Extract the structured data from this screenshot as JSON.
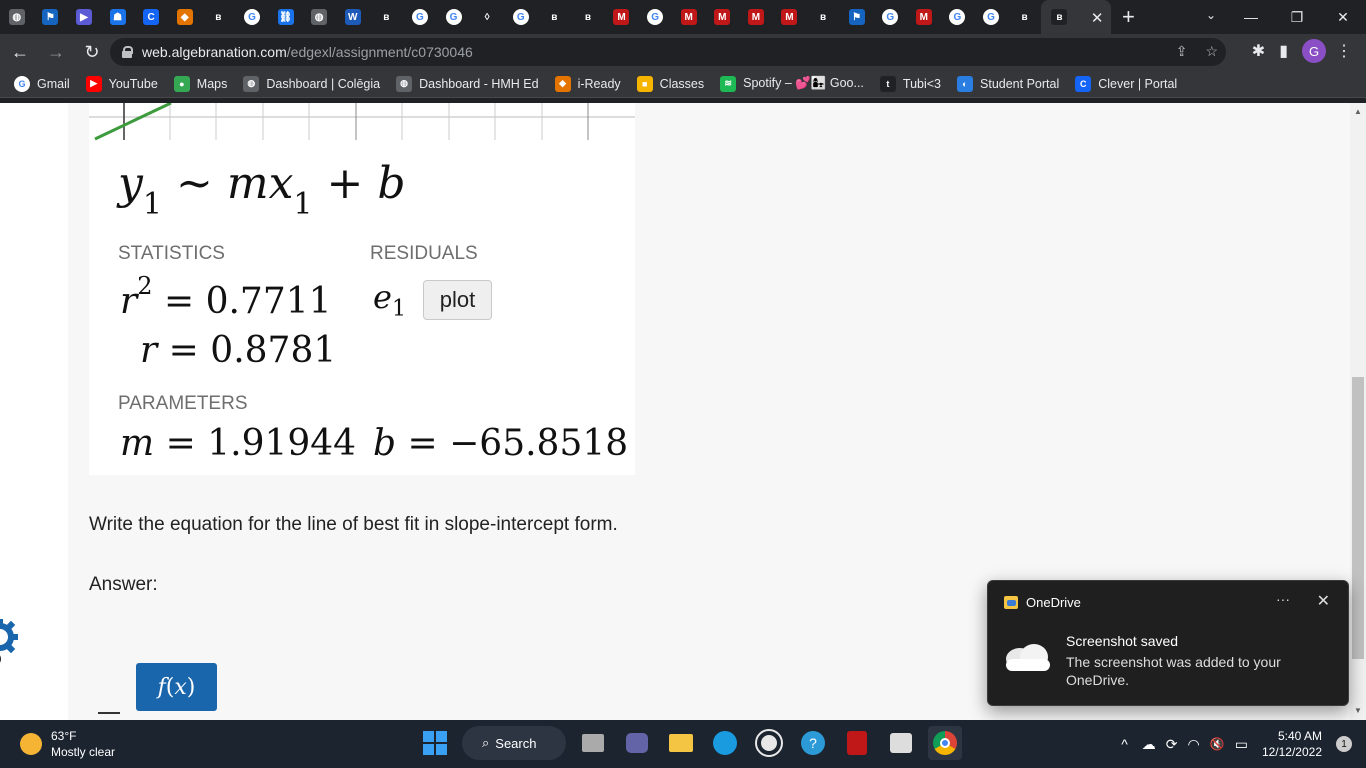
{
  "browser": {
    "tabs": [
      {
        "icon": "globe-icon",
        "color": "#5f6368",
        "glyph": "◍"
      },
      {
        "icon": "flag-icon",
        "color": "#1565c0",
        "glyph": "⚑"
      },
      {
        "icon": "play-icon",
        "color": "#5b5bd6",
        "glyph": "▶"
      },
      {
        "icon": "contact-icon",
        "color": "#1a73e8",
        "glyph": "☗"
      },
      {
        "icon": "clever-icon",
        "color": "#1464f6",
        "glyph": "C"
      },
      {
        "icon": "cube-icon",
        "color": "#e37400",
        "glyph": "◆"
      },
      {
        "icon": "b-icon",
        "color": "#202124",
        "glyph": "ʙ"
      },
      {
        "icon": "google-icon",
        "color": "#ffffff",
        "glyph": "G"
      },
      {
        "icon": "link-icon",
        "color": "#1a73e8",
        "glyph": "⛓"
      },
      {
        "icon": "globe-icon",
        "color": "#5f6368",
        "glyph": "◍"
      },
      {
        "icon": "word-icon",
        "color": "#1e5bb8",
        "glyph": "W"
      },
      {
        "icon": "b-icon",
        "color": "#202124",
        "glyph": "ʙ"
      },
      {
        "icon": "google-icon",
        "color": "#ffffff",
        "glyph": "G"
      },
      {
        "icon": "google-icon",
        "color": "#ffffff",
        "glyph": "G"
      },
      {
        "icon": "flame-icon",
        "color": "#202124",
        "glyph": "◊"
      },
      {
        "icon": "google-icon",
        "color": "#ffffff",
        "glyph": "G"
      },
      {
        "icon": "b-icon",
        "color": "#202124",
        "glyph": "ʙ"
      },
      {
        "icon": "b-icon",
        "color": "#202124",
        "glyph": "ʙ"
      },
      {
        "icon": "mcafee-icon",
        "color": "#c01818",
        "glyph": "M"
      },
      {
        "icon": "google-icon",
        "color": "#ffffff",
        "glyph": "G"
      },
      {
        "icon": "mcafee-icon",
        "color": "#c01818",
        "glyph": "M"
      },
      {
        "icon": "mcafee-icon",
        "color": "#c01818",
        "glyph": "M"
      },
      {
        "icon": "mcafee-icon",
        "color": "#c01818",
        "glyph": "M"
      },
      {
        "icon": "mcafee-icon",
        "color": "#c01818",
        "glyph": "M"
      },
      {
        "icon": "b-icon",
        "color": "#202124",
        "glyph": "ʙ"
      },
      {
        "icon": "flag-icon",
        "color": "#1565c0",
        "glyph": "⚑"
      },
      {
        "icon": "google-icon",
        "color": "#ffffff",
        "glyph": "G"
      },
      {
        "icon": "mcafee-icon",
        "color": "#c01818",
        "glyph": "M"
      },
      {
        "icon": "google-icon",
        "color": "#ffffff",
        "glyph": "G"
      },
      {
        "icon": "google-icon",
        "color": "#ffffff",
        "glyph": "G"
      },
      {
        "icon": "b-icon",
        "color": "#202124",
        "glyph": "ʙ"
      }
    ],
    "active_tab": {
      "icon": "b-icon",
      "glyph": "ʙ",
      "close": "✕"
    },
    "new_tab": "+",
    "window_controls": {
      "tab_search": "⌄",
      "minimize": "—",
      "maximize": "❐",
      "close": "✕"
    },
    "nav": {
      "back": "←",
      "forward": "→",
      "reload": "↻"
    },
    "url_host": "web.algebranation.com",
    "url_path": "/edgexl/assignment/c0730046",
    "omnibox_icons": {
      "share": "⇪",
      "star": "☆"
    },
    "toolbar_icons": {
      "extensions": "✱",
      "sidepanel": "▮"
    },
    "profile_initial": "G",
    "menu": "⋮",
    "bookmarks": [
      {
        "label": "Gmail",
        "icon": "google-icon",
        "color": "#ffffff",
        "glyph": "G"
      },
      {
        "label": "YouTube",
        "icon": "youtube-icon",
        "color": "#ff0000",
        "glyph": "▶"
      },
      {
        "label": "Maps",
        "icon": "maps-pin-icon",
        "color": "#34a853",
        "glyph": "●"
      },
      {
        "label": "Dashboard | Colēgia",
        "icon": "globe-icon",
        "color": "#5f6368",
        "glyph": "◍"
      },
      {
        "label": "Dashboard - HMH Ed",
        "icon": "globe-icon",
        "color": "#5f6368",
        "glyph": "◍"
      },
      {
        "label": "i-Ready",
        "icon": "cube-icon",
        "color": "#e37400",
        "glyph": "◆"
      },
      {
        "label": "Classes",
        "icon": "classroom-icon",
        "color": "#f5b400",
        "glyph": "■"
      },
      {
        "label": "Spotify – 💕👩‍👧 Goo...",
        "icon": "spotify-icon",
        "color": "#1db954",
        "glyph": "≋"
      },
      {
        "label": "Tubi<3",
        "icon": "tubi-icon",
        "color": "#202124",
        "glyph": "t"
      },
      {
        "label": "Student Portal",
        "icon": "portal-icon",
        "color": "#2a7de1",
        "glyph": "◐"
      },
      {
        "label": "Clever | Portal",
        "icon": "clever-icon",
        "color": "#1464f6",
        "glyph": "C"
      }
    ]
  },
  "regression": {
    "formula": {
      "y": "y",
      "y_sub": "1",
      "tilde": "~",
      "m": "m",
      "x": "x",
      "x_sub": "1",
      "plus": "+",
      "b": "b"
    },
    "statistics_label": "STATISTICS",
    "residuals_label": "RESIDUALS",
    "r2": {
      "r": "r",
      "exp": "2",
      "eq": "=",
      "value": "0.7711"
    },
    "r": {
      "r": "r",
      "eq": "=",
      "value": "0.8781"
    },
    "residual": {
      "e": "e",
      "sub": "1"
    },
    "plot_button": "plot",
    "parameters_label": "PARAMETERS",
    "m": {
      "name": "m",
      "eq": "=",
      "value": "1.91944"
    },
    "b": {
      "name": "b",
      "eq": "=",
      "value": "−65.8518"
    }
  },
  "question": "Write the equation for the line of best fit in slope-intercept form.",
  "answer_label": "Answer:",
  "fx_button": {
    "f": "f",
    "open": "(",
    "x": "x",
    "close": ")"
  },
  "notification": {
    "app": "OneDrive",
    "more": "···",
    "close": "✕",
    "title": "Screenshot saved",
    "body": "The screenshot was added to your OneDrive."
  },
  "taskbar": {
    "temp": "63°F",
    "condition": "Mostly clear",
    "search": "Search",
    "time": "5:40 AM",
    "date": "12/12/2022",
    "notif_count": "1",
    "tray": {
      "chevron": "^",
      "cloud": "☁",
      "sync": "⟳",
      "wifi": "◠",
      "volume": "🔇",
      "battery": "▭"
    }
  },
  "colors": {
    "accent": "#1a66ad",
    "graph_line": "#3c9b3c"
  }
}
